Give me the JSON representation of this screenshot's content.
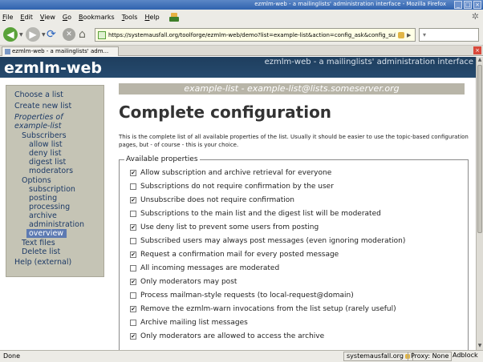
{
  "window": {
    "title": "ezmlm-web - a mailinglists' administration interface - Mozilla Firefox",
    "controls": [
      "_",
      "□",
      "×"
    ]
  },
  "menu": [
    "File",
    "Edit",
    "View",
    "Go",
    "Bookmarks",
    "Tools",
    "Help"
  ],
  "toolbar": {
    "url": "https://systemausfall.org/toolforge/ezmlm-web/demo?list=example-list&action=config_ask&config_subset=a",
    "search_placeholder": ""
  },
  "tab": {
    "label": "ezmlm-web - a mailinglists' adm...",
    "close": "×"
  },
  "page": {
    "site_title": "ezmlm-web",
    "site_subtitle": "ezmlm-web - a mailinglists' administration interface",
    "list_title": "example-list - example-list@lists.someserver.org",
    "heading": "Complete configuration",
    "intro": "This is the complete list of all available properties of the list. Usually it should be easier to use the topic-based configuration pages, but - of course - this is your choice.",
    "legend": "Available properties"
  },
  "sidebar": {
    "items": [
      {
        "label": "Choose a list",
        "level": 0,
        "style": "normal"
      },
      {
        "label": "Create new list",
        "level": 0,
        "style": "normal"
      },
      {
        "label": "Properties of",
        "level": 0,
        "style": "heading"
      },
      {
        "label": "example-list",
        "level": 0,
        "style": "heading"
      },
      {
        "label": "Subscribers",
        "level": 1,
        "style": "normal"
      },
      {
        "label": "allow list",
        "level": 2,
        "style": "normal"
      },
      {
        "label": "deny list",
        "level": 2,
        "style": "normal"
      },
      {
        "label": "digest list",
        "level": 2,
        "style": "normal"
      },
      {
        "label": "moderators",
        "level": 2,
        "style": "normal"
      },
      {
        "label": "Options",
        "level": 1,
        "style": "normal"
      },
      {
        "label": "subscription",
        "level": 2,
        "style": "normal"
      },
      {
        "label": "posting",
        "level": 2,
        "style": "normal"
      },
      {
        "label": "processing",
        "level": 2,
        "style": "normal"
      },
      {
        "label": "archive",
        "level": 2,
        "style": "normal"
      },
      {
        "label": "administration",
        "level": 2,
        "style": "normal"
      },
      {
        "label": "overview",
        "level": 2,
        "style": "active"
      },
      {
        "label": "Text files",
        "level": 1,
        "style": "normal"
      },
      {
        "label": "Delete list",
        "level": 1,
        "style": "normal"
      },
      {
        "label": "Help (external)",
        "level": 0,
        "style": "normal"
      }
    ]
  },
  "options": [
    {
      "label": "Allow subscription and archive retrieval for everyone",
      "checked": true
    },
    {
      "label": "Subscriptions do not require confirmation by the user",
      "checked": false
    },
    {
      "label": "Unsubscribe does not require confirmation",
      "checked": true
    },
    {
      "label": "Subscriptions to the main list and the digest list will be moderated",
      "checked": false
    },
    {
      "label": "Use deny list to prevent some users from posting",
      "checked": true
    },
    {
      "label": "Subscribed users may always post messages (even ignoring moderation)",
      "checked": false
    },
    {
      "label": "Request a confirmation mail for every posted message",
      "checked": true
    },
    {
      "label": "All incoming messages are moderated",
      "checked": false
    },
    {
      "label": "Only moderators may post",
      "checked": true
    },
    {
      "label": "Process mailman-style requests (to local-request@domain)",
      "checked": false
    },
    {
      "label": "Remove the ezmlm-warn invocations from the list setup (rarely useful)",
      "checked": true
    },
    {
      "label": "Archive mailing list messages",
      "checked": false
    },
    {
      "label": "Only moderators are allowed to access the archive",
      "checked": true
    }
  ],
  "status": {
    "text": "Done",
    "site": "systemausfall.org",
    "proxy": "Proxy: None",
    "adblock": "Adblock"
  }
}
